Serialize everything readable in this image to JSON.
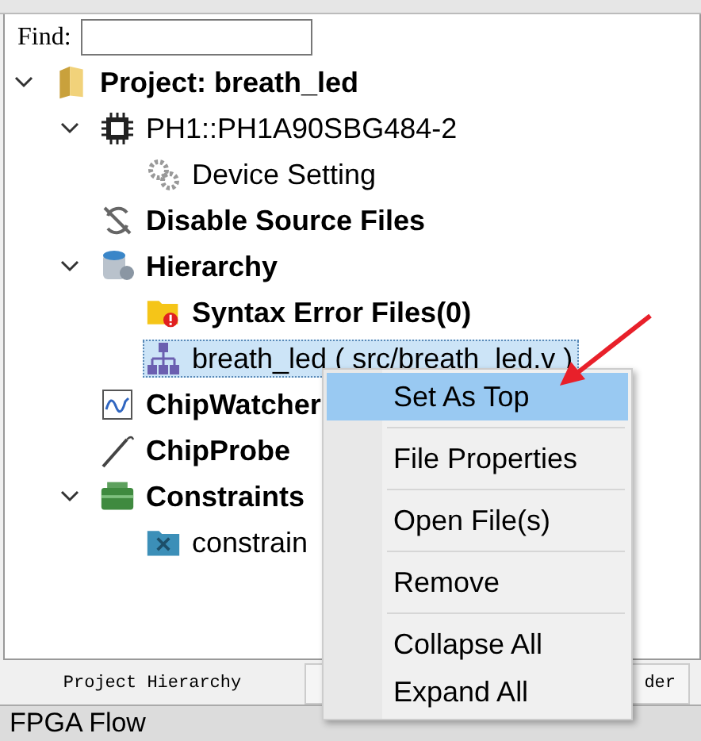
{
  "find": {
    "label": "Find:"
  },
  "tree": [
    {
      "label": "Project: breath_led",
      "kind": "project",
      "bold": true,
      "expanded": true,
      "selected": false,
      "children": [
        {
          "label": "PH1::PH1A90SBG484-2",
          "kind": "chip",
          "bold": false,
          "expanded": true,
          "selected": false,
          "children": [
            {
              "label": "Device Setting",
              "kind": "gears",
              "bold": false,
              "selected": false
            }
          ]
        },
        {
          "label": "Disable Source Files",
          "kind": "disable",
          "bold": true,
          "selected": false
        },
        {
          "label": "Hierarchy",
          "kind": "database",
          "bold": true,
          "expanded": true,
          "selected": false,
          "children": [
            {
              "label": "Syntax Error Files(0)",
              "kind": "errorfolder",
              "bold": true,
              "selected": false
            },
            {
              "label": "breath_led ( src/breath_led.v )",
              "kind": "module",
              "bold": false,
              "selected": true
            }
          ]
        },
        {
          "label": "ChipWatcher",
          "kind": "wave",
          "bold": true,
          "selected": false
        },
        {
          "label": "ChipProbe",
          "kind": "probe",
          "bold": true,
          "selected": false
        },
        {
          "label": "Constraints",
          "kind": "constraints",
          "bold": true,
          "expanded": true,
          "selected": false,
          "children": [
            {
              "label": "constrain",
              "kind": "toolfolder",
              "bold": false,
              "selected": false
            }
          ]
        }
      ]
    }
  ],
  "menu": [
    {
      "kind": "item",
      "label": "Set As Top",
      "selected": true
    },
    {
      "kind": "separator"
    },
    {
      "kind": "item",
      "label": "File Properties",
      "selected": false
    },
    {
      "kind": "separator"
    },
    {
      "kind": "item",
      "label": "Open File(s)",
      "selected": false
    },
    {
      "kind": "separator"
    },
    {
      "kind": "item",
      "label": "Remove",
      "selected": false
    },
    {
      "kind": "separator"
    },
    {
      "kind": "item",
      "label": "Collapse All",
      "selected": false
    },
    {
      "kind": "item",
      "label": "Expand All",
      "selected": false
    }
  ],
  "tabs": [
    {
      "label": "Project Hierarchy",
      "selected": true
    },
    {
      "label": "der",
      "selected": false
    }
  ],
  "bottom_panel": {
    "title": "FPGA Flow"
  }
}
